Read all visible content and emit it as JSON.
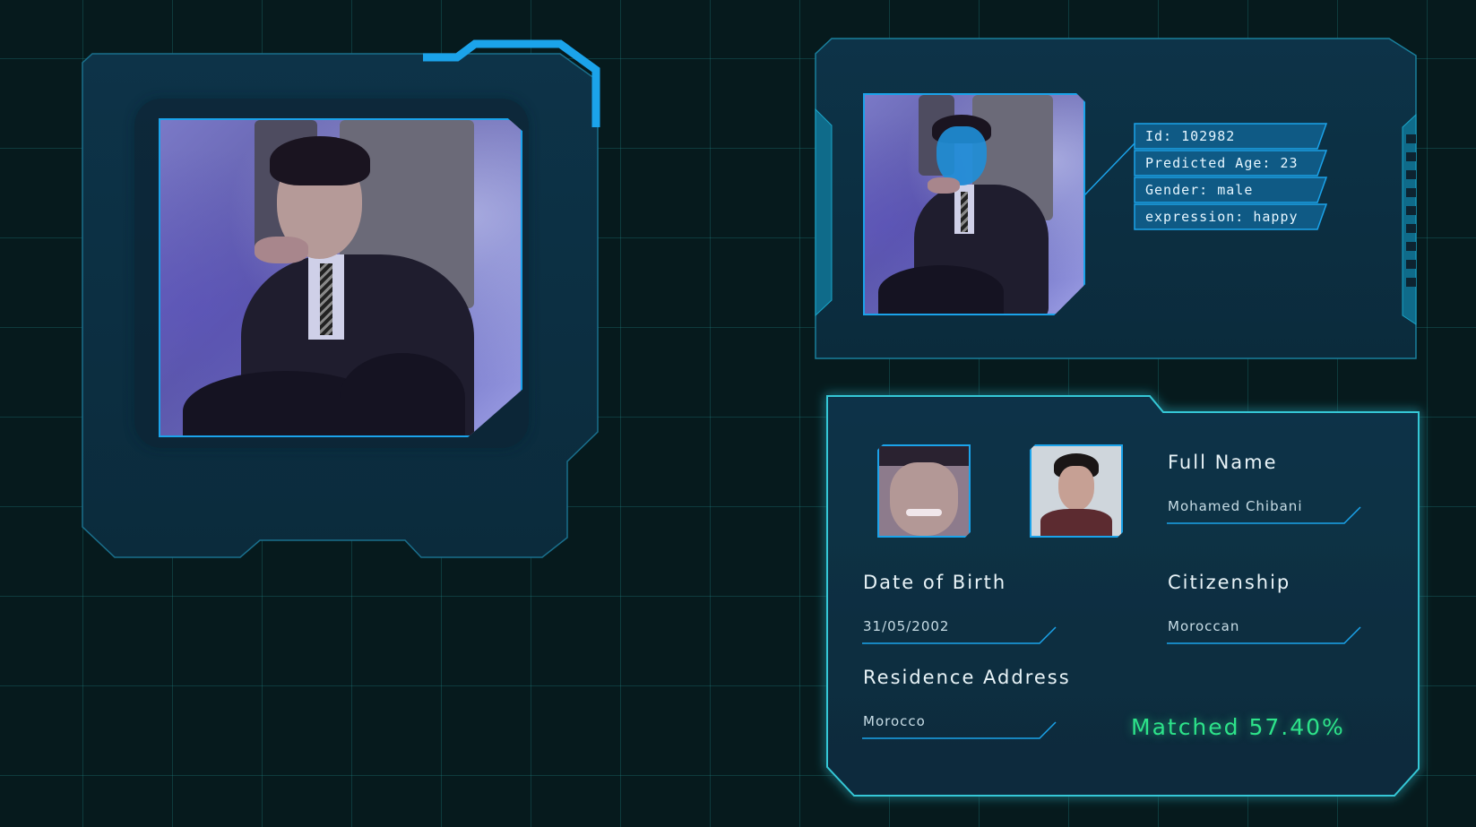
{
  "detection": {
    "id": "Id: 102982",
    "age": "Predicted Age: 23",
    "gender": "Gender: male",
    "expression": "expression: happy"
  },
  "profile": {
    "full_name_label": "Full Name",
    "full_name": "Mohamed Chibani",
    "dob_label": "Date of Birth",
    "dob": "31/05/2002",
    "citizenship_label": "Citizenship",
    "citizenship": "Moroccan",
    "address_label": "Residence Address",
    "address": "Morocco",
    "match": "Matched 57.40%"
  },
  "colors": {
    "accent": "#19a9e8",
    "panel": "#0c3347",
    "match": "#2de38a"
  }
}
